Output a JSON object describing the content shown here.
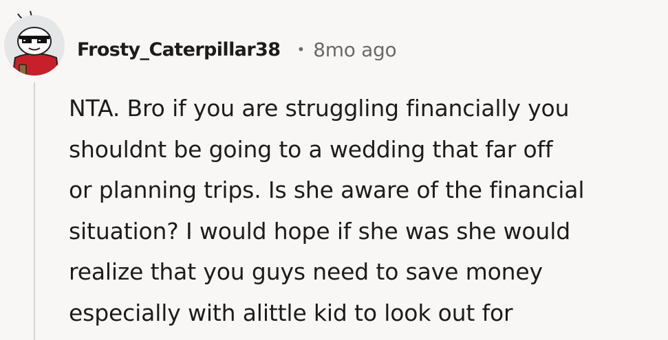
{
  "comment": {
    "author": "Frosty_Caterpillar38",
    "separator": "•",
    "timestamp": "8mo ago",
    "body_lines": [
      "NTA. Bro if you are struggling financially you",
      "shouldnt be going to a wedding that far off",
      "or planning trips. Is she aware of the financial",
      "situation? I would hope if she was she would",
      "realize that you guys need to save money",
      "especially with alittle kid to look out for"
    ]
  },
  "colors": {
    "background": "#f8f7f6",
    "text": "#1c1c1c",
    "meta": "#6b6966",
    "thread_line": "#d6d4d1",
    "avatar_bg": "#e4e6e8",
    "avatar_shirt": "#c8202a"
  },
  "icons": {
    "avatar": "snoo-avatar-sunglasses"
  }
}
